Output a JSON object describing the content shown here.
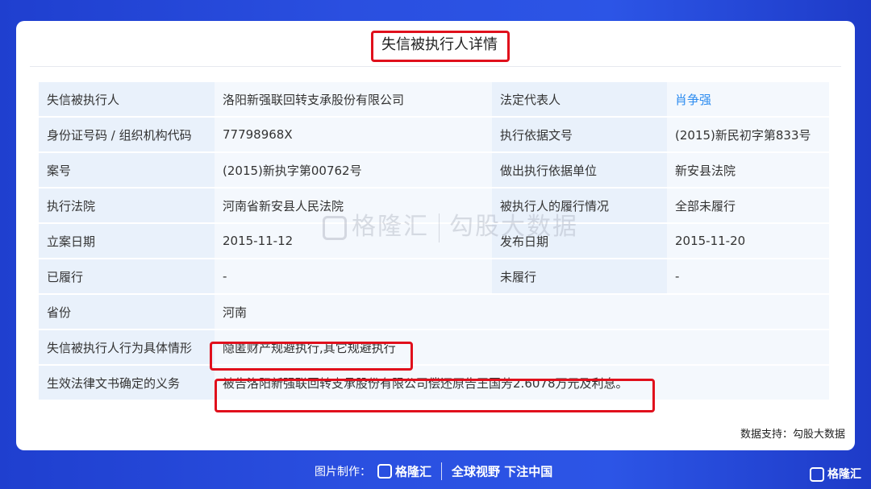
{
  "title": "失信被执行人详情",
  "rows": [
    {
      "l1": "失信被执行人",
      "v1": "洛阳新强联回转支承股份有限公司",
      "l2": "法定代表人",
      "v2": "肖争强"
    },
    {
      "l1": "身份证号码 / 组织机构代码",
      "v1": "77798968X",
      "l2": "执行依据文号",
      "v2": "(2015)新民初字第833号"
    },
    {
      "l1": "案号",
      "v1": "(2015)新执字第00762号",
      "l2": "做出执行依据单位",
      "v2": "新安县法院"
    },
    {
      "l1": "执行法院",
      "v1": "河南省新安县人民法院",
      "l2": "被执行人的履行情况",
      "v2": "全部未履行"
    },
    {
      "l1": "立案日期",
      "v1": "2015-11-12",
      "l2": "发布日期",
      "v2": "2015-11-20"
    },
    {
      "l1": "已履行",
      "v1": "-",
      "l2": "未履行",
      "v2": "-"
    }
  ],
  "wide_rows": [
    {
      "l": "省份",
      "v": "河南"
    },
    {
      "l": "失信被执行人行为具体情形",
      "v": "隐匿财产规避执行,其它规避执行"
    },
    {
      "l": "生效法律文书确定的义务",
      "v": "被告洛阳新强联回转支承股份有限公司偿还原告王国芳2.6078万元及利息。"
    }
  ],
  "source": "数据支持：勾股大数据",
  "watermark": {
    "brand": "格隆汇",
    "text": "勾股大数据"
  },
  "footer": {
    "made_by": "图片制作：",
    "brand": "格隆汇",
    "slogan": "全球视野 下注中国"
  },
  "corner_brand": "格隆汇",
  "colors": {
    "highlight": "#e0101c",
    "link": "#2d8cf0",
    "label_bg": "#e9f1fb",
    "value_bg": "#f4f8fd"
  }
}
